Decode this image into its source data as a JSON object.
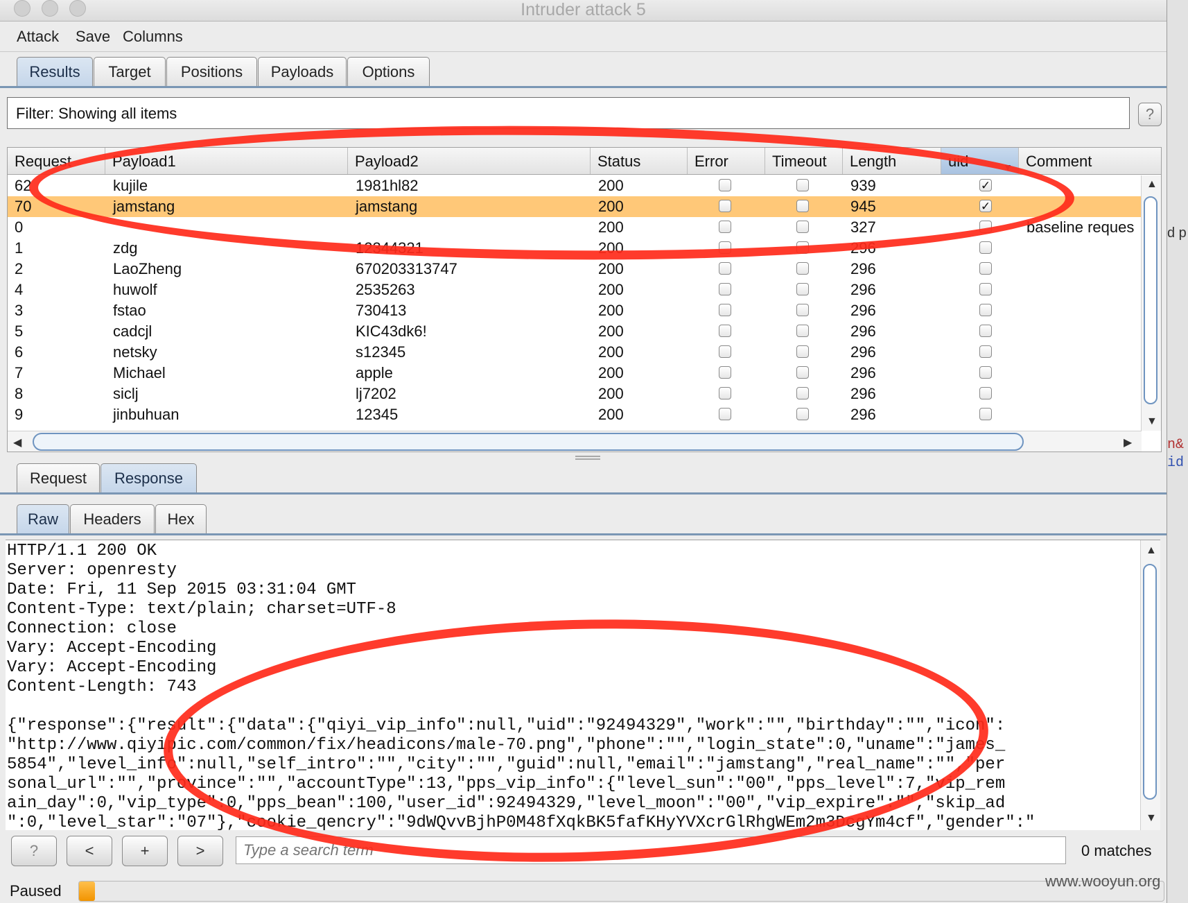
{
  "window": {
    "title": "Intruder attack 5"
  },
  "menu": [
    "Attack",
    "Save",
    "Columns"
  ],
  "main_tabs": [
    {
      "label": "Results",
      "active": true
    },
    {
      "label": "Target",
      "active": false
    },
    {
      "label": "Positions",
      "active": false
    },
    {
      "label": "Payloads",
      "active": false
    },
    {
      "label": "Options",
      "active": false
    }
  ],
  "filter": {
    "text": "Filter: Showing all items",
    "help_label": "?"
  },
  "results_table": {
    "columns": [
      "Request",
      "Payload1",
      "Payload2",
      "Status",
      "Error",
      "Timeout",
      "Length",
      "uid",
      "Comment"
    ],
    "sorted_column": "uid",
    "rows": [
      {
        "request": "62",
        "payload1": "kujile",
        "payload2": "1981hl82",
        "status": "200",
        "error": false,
        "timeout": false,
        "length": "939",
        "uid": true,
        "comment": "",
        "selected": false
      },
      {
        "request": "70",
        "payload1": "jamstang",
        "payload2": "jamstang",
        "status": "200",
        "error": false,
        "timeout": false,
        "length": "945",
        "uid": true,
        "comment": "",
        "selected": true
      },
      {
        "request": "0",
        "payload1": "",
        "payload2": "",
        "status": "200",
        "error": false,
        "timeout": false,
        "length": "327",
        "uid": false,
        "comment": "baseline reques",
        "selected": false
      },
      {
        "request": "1",
        "payload1": "zdg",
        "payload2": "12344321",
        "status": "200",
        "error": false,
        "timeout": false,
        "length": "296",
        "uid": false,
        "comment": "",
        "selected": false
      },
      {
        "request": "2",
        "payload1": "LaoZheng",
        "payload2": "670203313747",
        "status": "200",
        "error": false,
        "timeout": false,
        "length": "296",
        "uid": false,
        "comment": "",
        "selected": false
      },
      {
        "request": "4",
        "payload1": "huwolf",
        "payload2": "2535263",
        "status": "200",
        "error": false,
        "timeout": false,
        "length": "296",
        "uid": false,
        "comment": "",
        "selected": false
      },
      {
        "request": "3",
        "payload1": "fstao",
        "payload2": "730413",
        "status": "200",
        "error": false,
        "timeout": false,
        "length": "296",
        "uid": false,
        "comment": "",
        "selected": false
      },
      {
        "request": "5",
        "payload1": "cadcjl",
        "payload2": "KIC43dk6!",
        "status": "200",
        "error": false,
        "timeout": false,
        "length": "296",
        "uid": false,
        "comment": "",
        "selected": false
      },
      {
        "request": "6",
        "payload1": "netsky",
        "payload2": "s12345",
        "status": "200",
        "error": false,
        "timeout": false,
        "length": "296",
        "uid": false,
        "comment": "",
        "selected": false
      },
      {
        "request": "7",
        "payload1": "Michael",
        "payload2": "apple",
        "status": "200",
        "error": false,
        "timeout": false,
        "length": "296",
        "uid": false,
        "comment": "",
        "selected": false
      },
      {
        "request": "8",
        "payload1": "siclj",
        "payload2": "lj7202",
        "status": "200",
        "error": false,
        "timeout": false,
        "length": "296",
        "uid": false,
        "comment": "",
        "selected": false
      },
      {
        "request": "9",
        "payload1": "jinbuhuan",
        "payload2": "12345",
        "status": "200",
        "error": false,
        "timeout": false,
        "length": "296",
        "uid": false,
        "comment": "",
        "selected": false
      }
    ]
  },
  "detail_tabs": [
    {
      "label": "Request",
      "active": false
    },
    {
      "label": "Response",
      "active": true
    }
  ],
  "view_tabs": [
    {
      "label": "Raw",
      "active": true
    },
    {
      "label": "Headers",
      "active": false
    },
    {
      "label": "Hex",
      "active": false
    }
  ],
  "response_lines": [
    "HTTP/1.1 200 OK",
    "Server: openresty",
    "Date: Fri, 11 Sep 2015 03:31:04 GMT",
    "Content-Type: text/plain; charset=UTF-8",
    "Connection: close",
    "Vary: Accept-Encoding",
    "Vary: Accept-Encoding",
    "Content-Length: 743",
    "",
    "{\"response\":{\"result\":{\"data\":{\"qiyi_vip_info\":null,\"uid\":\"92494329\",\"work\":\"\",\"birthday\":\"\",\"icon\":",
    "\"http://www.qiyipic.com/common/fix/headicons/male-70.png\",\"phone\":\"\",\"login_state\":0,\"uname\":\"james_",
    "5854\",\"level_info\":null,\"self_intro\":\"\",\"city\":\"\",\"guid\":null,\"email\":\"jamstang\",\"real_name\":\"\",\"per",
    "sonal_url\":\"\",\"province\":\"\",\"accountType\":13,\"pps_vip_info\":{\"level_sun\":\"00\",\"pps_level\":7,\"vip_rem",
    "ain_day\":0,\"vip_type\":0,\"pps_bean\":100,\"user_id\":92494329,\"level_moon\":\"00\",\"vip_expire\":\"\",\"skip_ad",
    "\":0,\"level_star\":\"07\"},\"cookie_qencry\":\"9dWQvvBjhP0M48fXqkBK5fafKHyYVXcrGlRhgWEm2m3DcgYm4cf\",\"gender\":\""
  ],
  "search": {
    "help_label": "?",
    "prev_label": "<",
    "add_label": "+",
    "next_label": ">",
    "placeholder": "Type a search term",
    "matches": "0 matches"
  },
  "status_bar": {
    "text": "Paused",
    "progress": 0.015
  },
  "watermark": "www.wooyun.org",
  "background_fragments": [
    "d p",
    "n&",
    "id"
  ]
}
